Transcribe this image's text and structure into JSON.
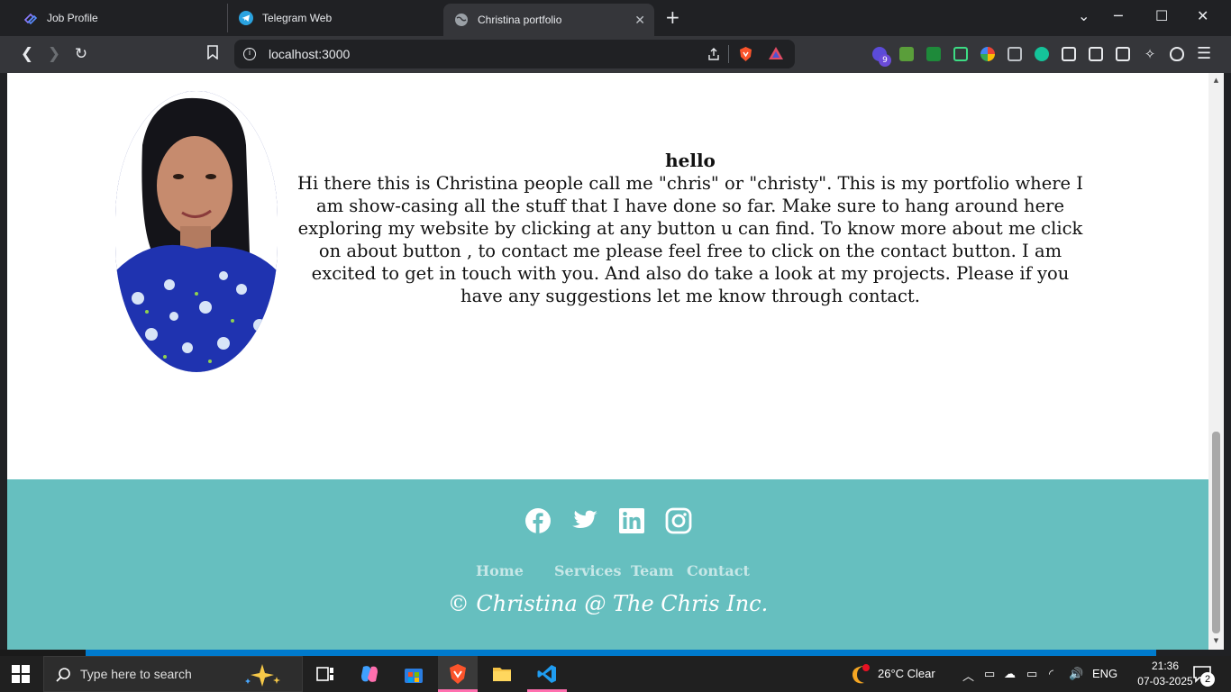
{
  "browser": {
    "tabs": [
      {
        "title": "Job Profile",
        "icon": "job-profile-icon"
      },
      {
        "title": "Telegram Web",
        "icon": "telegram-icon"
      },
      {
        "title": "Christina portfolio",
        "icon": "globe-icon"
      }
    ],
    "url": "localhost:3000",
    "extension_badge": "9"
  },
  "page": {
    "about_heading": "hello",
    "about_text": "Hi there this is Christina people call me \"chris\" or \"christy\". This is my portfolio where I am show-casing all the stuff that I have done so far. Make sure to hang around here exploring my website by clicking at any button u can find. To know more about me click on about button , to contact me please feel free to click on the contact button. I am excited to get in touch with you. And also do take a look at my projects. Please if you have any suggestions let me know through contact.",
    "social_icons": [
      "facebook-icon",
      "twitter-icon",
      "linkedin-icon",
      "instagram-icon"
    ],
    "footer_nav": [
      "Home",
      "Services",
      "Team",
      "Contact"
    ],
    "copyright": "© Christina @ The Chris Inc.",
    "colors": {
      "footer_bg": "#66bfbf",
      "footer_link": "#c7e7e7"
    }
  },
  "taskbar": {
    "search_placeholder": "Type here to search",
    "weather": "26°C  Clear",
    "language": "ENG",
    "time": "21:36",
    "date": "07-03-2025",
    "notification_count": "2"
  }
}
